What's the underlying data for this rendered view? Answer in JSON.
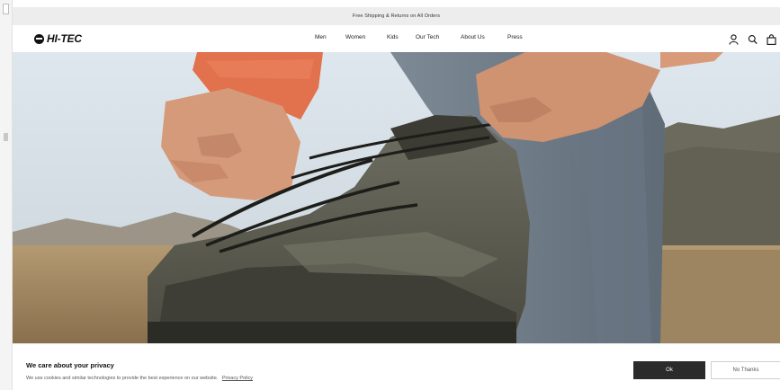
{
  "announcement": {
    "text": "Free Shipping & Returns on All Orders"
  },
  "header": {
    "logo_text": "HI-TEC",
    "nav": {
      "men": "Men",
      "women": "Women",
      "kids": "Kids",
      "our_tech": "Our Tech",
      "about_us": "About Us",
      "press": "Press"
    },
    "icons": [
      "account-icon",
      "search-icon",
      "cart-icon"
    ]
  },
  "hero": {
    "image": "hiking-boot-lacing-photo"
  },
  "cookie_banner": {
    "title": "We care about your privacy",
    "text": "We use cookies and similar technologies to provide the best experience on our website.",
    "policy_link": "Privacy Policy",
    "ok_label": "Ok",
    "no_label": "No Thanks"
  },
  "colors": {
    "dark_button": "#2b2b2b",
    "announcement_bg": "#ededed"
  }
}
